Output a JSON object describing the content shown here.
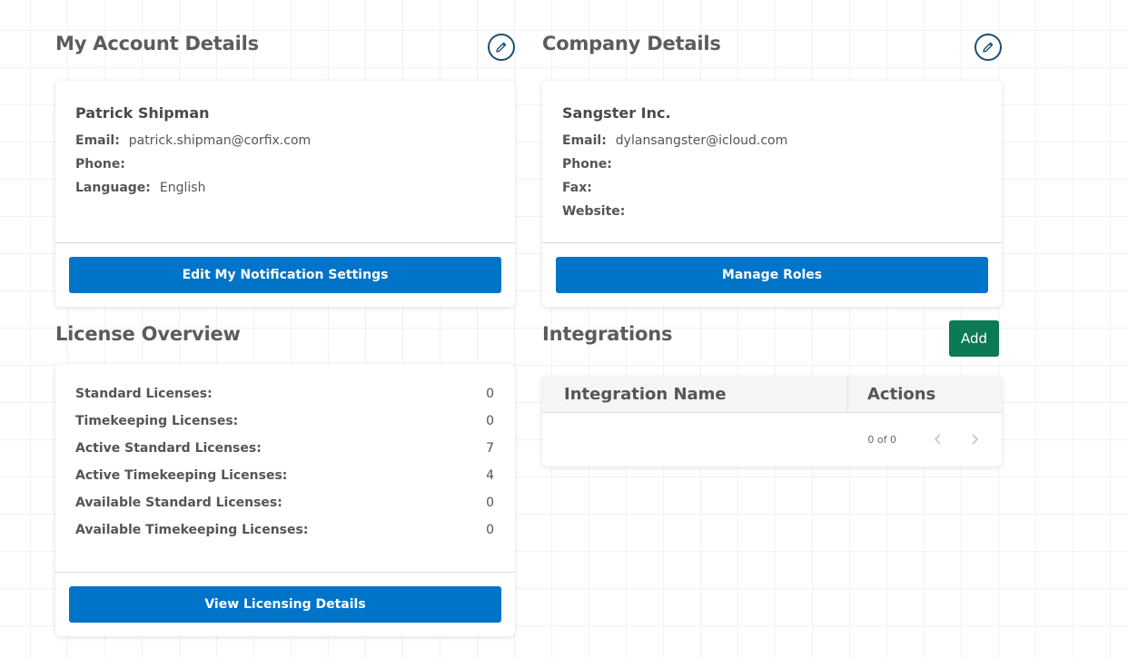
{
  "account": {
    "title": "My Account Details",
    "name": "Patrick Shipman",
    "email_label": "Email:",
    "email": "patrick.shipman@corfix.com",
    "phone_label": "Phone:",
    "phone": "",
    "language_label": "Language:",
    "language": "English",
    "button": "Edit My Notification Settings",
    "edit_icon": "pencil-icon"
  },
  "company": {
    "title": "Company Details",
    "name": "Sangster Inc.",
    "email_label": "Email:",
    "email": "dylansangster@icloud.com",
    "phone_label": "Phone:",
    "phone": "",
    "fax_label": "Fax:",
    "fax": "",
    "website_label": "Website:",
    "website": "",
    "button": "Manage Roles",
    "edit_icon": "pencil-icon"
  },
  "licenses": {
    "title": "License Overview",
    "rows": [
      {
        "label": "Standard Licenses:",
        "value": "0"
      },
      {
        "label": "Timekeeping Licenses:",
        "value": "0"
      },
      {
        "label": "Active Standard Licenses:",
        "value": "7"
      },
      {
        "label": "Active Timekeeping Licenses:",
        "value": "4"
      },
      {
        "label": "Available Standard Licenses:",
        "value": "0"
      },
      {
        "label": "Available Timekeeping Licenses:",
        "value": "0"
      }
    ],
    "button": "View Licensing Details"
  },
  "integrations": {
    "title": "Integrations",
    "add_button": "Add",
    "columns": [
      "Integration Name",
      "Actions"
    ],
    "rows": [],
    "pager": {
      "count": "0 of 0",
      "prev_icon": "chevron-left-icon",
      "next_icon": "chevron-right-icon"
    }
  },
  "colors": {
    "primary": "#0074c8",
    "success": "#0b7a55",
    "icon_outline": "#1d4f73"
  }
}
